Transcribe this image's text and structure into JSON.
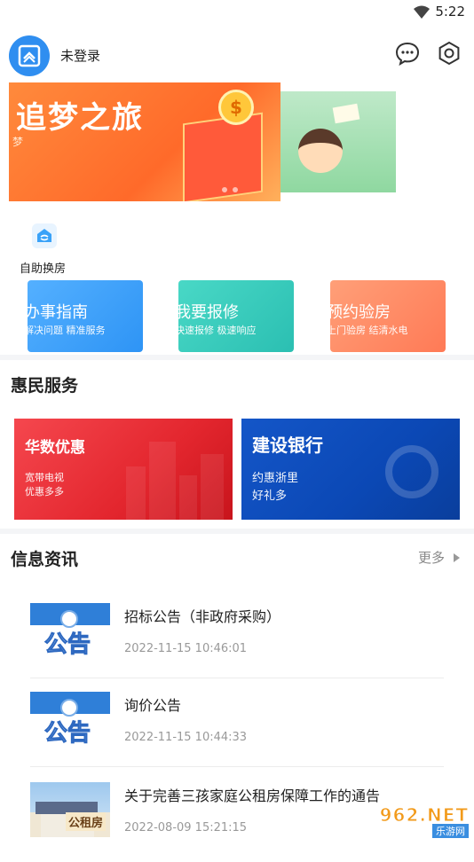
{
  "status_bar": {
    "time": "5:22",
    "wifi_icon": "wifi-icon"
  },
  "header": {
    "avatar_icon": "building-logo-icon",
    "username": "未登录",
    "message_icon": "message-icon",
    "settings_icon": "settings-hexagon-icon"
  },
  "banner": {
    "slide1_title": "追梦之旅",
    "slide1_sub": "梦"
  },
  "self_service": {
    "icon": "house-exchange-icon",
    "label": "自助换房"
  },
  "quick_cards": [
    {
      "title": "办事指南",
      "sub": "解决问题 精准服务",
      "color": "#3aa2f8"
    },
    {
      "title": "我要报修",
      "sub": "快速报修 极速响应",
      "color": "#3ccdbd"
    },
    {
      "title": "预约验房",
      "sub": "上门验房 结清水电",
      "color": "#ff8c66"
    }
  ],
  "benefits": {
    "title": "惠民服务",
    "cards": [
      {
        "title": "华数优惠",
        "line1": "宽带电视",
        "line2": "优惠多多",
        "color": "#e9343b"
      },
      {
        "title": "建设银行",
        "line1": "约惠浙里",
        "line2": "好礼多",
        "color": "#0e4fbf"
      }
    ]
  },
  "news": {
    "title": "信息资讯",
    "more_label": "更多",
    "thumb_text": "公告",
    "photo_text": "公租房",
    "items": [
      {
        "title": "招标公告（非政府采购）",
        "date": "2022-11-15 10:46:01"
      },
      {
        "title": "询价公告",
        "date": "2022-11-15 10:44:33"
      },
      {
        "title": "关于完善三孩家庭公租房保障工作的通告",
        "date": "2022-08-09 15:21:15"
      }
    ]
  },
  "watermark": {
    "main": "962.NET",
    "sub": "乐游网"
  }
}
